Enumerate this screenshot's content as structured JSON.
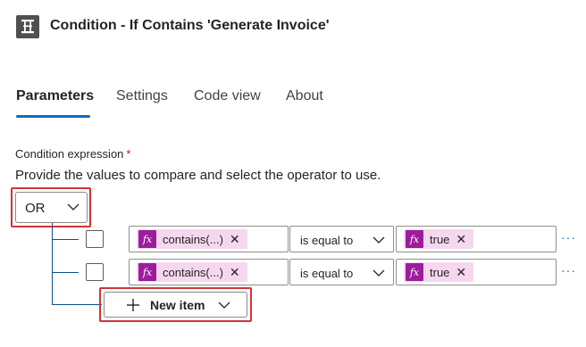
{
  "header": {
    "title": "Condition - If Contains 'Generate Invoice'",
    "icon": "condition-icon"
  },
  "tabs": [
    {
      "label": "Parameters",
      "active": true
    },
    {
      "label": "Settings",
      "active": false
    },
    {
      "label": "Code view",
      "active": false
    },
    {
      "label": "About",
      "active": false
    }
  ],
  "condition": {
    "label": "Condition expression",
    "required_mark": "*",
    "helper": "Provide the values to compare and select the operator to use.",
    "group_operator": "OR",
    "rows": [
      {
        "left_token": "contains(...)",
        "operator": "is equal to",
        "right_token": "true",
        "more": "···"
      },
      {
        "left_token": "contains(...)",
        "operator": "is equal to",
        "right_token": "true",
        "more": "···"
      }
    ],
    "new_item_label": "New item",
    "fx_label": "fx"
  },
  "colors": {
    "accent": "#0f6cbd",
    "highlight": "#d13438",
    "token_bg": "#f5d8ee",
    "fx_bg": "#9c1c9c"
  }
}
